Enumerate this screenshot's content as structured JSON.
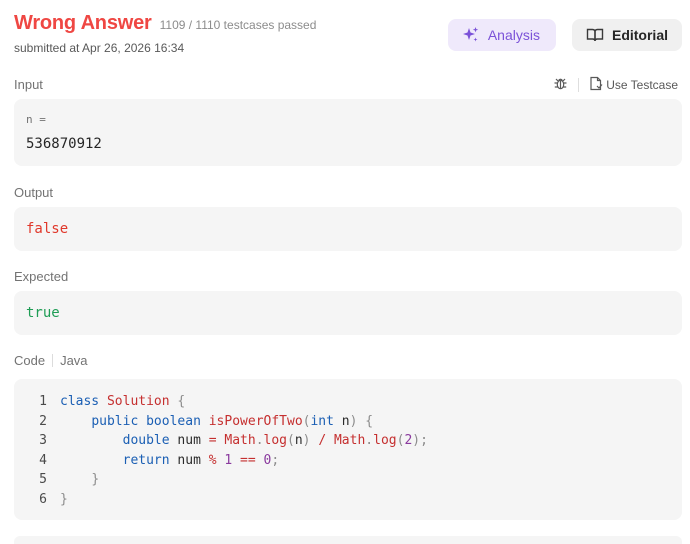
{
  "status": {
    "title": "Wrong Answer",
    "passed": "1109 / 1110 testcases passed",
    "submitted": "submitted at Apr 26, 2026 16:34"
  },
  "buttons": {
    "analysis": "Analysis",
    "editorial": "Editorial"
  },
  "input": {
    "label": "Input",
    "use_testcase": "Use Testcase",
    "var_name": "n =",
    "value": "536870912"
  },
  "output": {
    "label": "Output",
    "value": "false"
  },
  "expected": {
    "label": "Expected",
    "value": "true"
  },
  "code": {
    "label": "Code",
    "language": "Java",
    "line_numbers": [
      "1",
      "2",
      "3",
      "4",
      "5",
      "6"
    ]
  },
  "colors": {
    "wrong": "#ef4743",
    "analysis_bg": "#efe9fb",
    "analysis_fg": "#7b52d8",
    "false": "#e0382b",
    "true": "#1f9d55"
  },
  "icons": {
    "analysis": "sparkle-icon",
    "editorial": "book-icon",
    "debug": "bug-icon",
    "use_testcase": "file-icon"
  }
}
